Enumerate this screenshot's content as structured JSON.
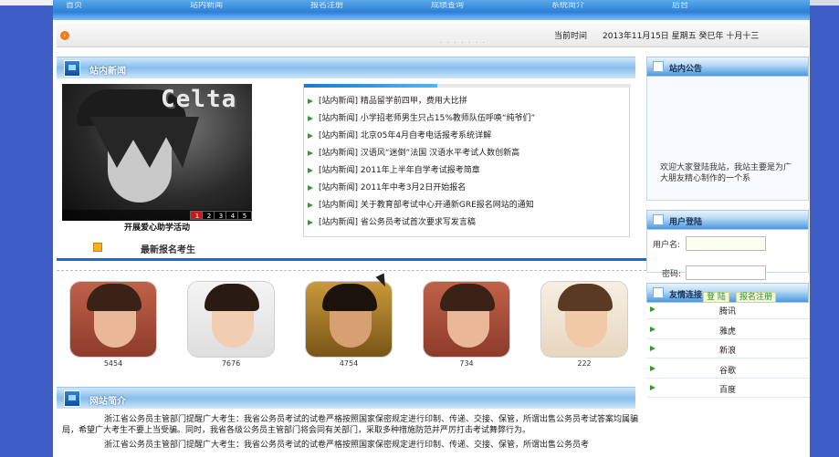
{
  "nav": {
    "items": [
      "首页",
      "站内新闻",
      "报名注册",
      "成绩查询",
      "系统简介",
      "后台"
    ]
  },
  "infobar": {
    "dots": ". . . . . . .",
    "date_label": "当前时间",
    "date_value": "2013年11月15日  星期五  癸巳年  十月十三"
  },
  "news_section": {
    "title": "站内新闻",
    "slider": {
      "logo_text": "Celta",
      "page_numbers": [
        "1",
        "2",
        "3",
        "4",
        "5"
      ],
      "active_page": "1",
      "caption": "开展爱心助学活动"
    },
    "items": [
      "[站内新闻] 精品留学前四甲，费用大比拼",
      "[站内新闻] 小学招老师男生只占15%教师队伍呼唤“纯爷们”",
      "[站内新闻] 北京05年4月自考电话报考系统详解",
      "[站内新闻] 汉语风“迷倒”法国 汉语水平考试人数创新高",
      "[站内新闻] 2011年上半年自学考试报考简章",
      "[站内新闻] 2011年中考3月2日开始报名",
      "[站内新闻] 关于教育部考试中心开通新GRE报名网站的通知",
      "[站内新闻] 省公务员考试首次要求写发言稿"
    ]
  },
  "latest": {
    "title": "最新报名考生"
  },
  "photos": [
    {
      "caption": "5454"
    },
    {
      "caption": "7676"
    },
    {
      "caption": "4754"
    },
    {
      "caption": "734"
    },
    {
      "caption": "222"
    }
  ],
  "intro": {
    "title": "网站简介",
    "paragraphs": [
      "浙江省公务员主管部门提醒广大考生：我省公务员考试的试卷严格按照国家保密规定进行印制、传递、交接、保管，所谓出售公务员考试答案均属骗局，希望广大考生不要上当受骗。同时，我省各级公务员主管部门将会同有关部门，采取多种措施防范并严厉打击考试舞弊行为。",
      "浙江省公务员主管部门提醒广大考生：我省公务员考试的试卷严格按照国家保密规定进行印制、传递、交接、保管，所谓出售公务员考"
    ]
  },
  "notice": {
    "title": "站内公告",
    "text": "欢迎大家登陆我站，我站主要是为广大朋友精心制作的一个系"
  },
  "login": {
    "title": "用户登陆",
    "username_label": "用户名:",
    "password_label": "密码:",
    "login_button": "登 陆",
    "register_button": "报名注册"
  },
  "links": {
    "title": "友情连接",
    "items": [
      "腾讯",
      "雅虎",
      "新浪",
      "谷歌",
      "百度"
    ]
  },
  "colors": {
    "nav_blue": "#2d7fd6",
    "accent_orange": "#ee7d1c",
    "bullet_green": "#2f9a2f",
    "active_page_red": "#c71a1a",
    "page_background": "#3f5fc7"
  }
}
